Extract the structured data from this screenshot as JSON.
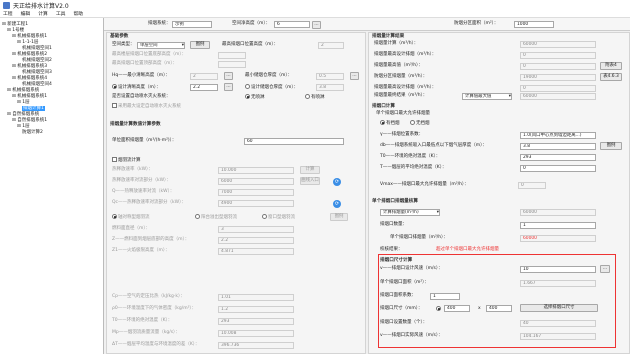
{
  "window": {
    "title": "天正给排水计算V2.0"
  },
  "menu": [
    "工程",
    "编辑",
    "计算",
    "工具",
    "帮助"
  ],
  "topbar": {
    "name_label": "排烟系统：",
    "name_value": "示例",
    "space_h_label": "空间净高度（m）：",
    "space_h_value": "6",
    "area_label": "防烟分区面积（m²）：",
    "area_value": "1000"
  },
  "tree": [
    {
      "t": "新建工程1",
      "l": 0
    },
    {
      "t": "1号楼",
      "l": 1
    },
    {
      "t": "机械排烟系统1",
      "l": 2
    },
    {
      "t": "1-1-1层",
      "l": 3
    },
    {
      "t": "机械排烟空间1",
      "l": 4
    },
    {
      "t": "机械排烟系统2",
      "l": 2
    },
    {
      "t": "机械排烟空间2",
      "l": 4
    },
    {
      "t": "机械排烟系统3",
      "l": 2
    },
    {
      "t": "机械排烟空间3",
      "l": 4
    },
    {
      "t": "机械排烟系统4",
      "l": 2
    },
    {
      "t": "机械排烟空间4",
      "l": 4
    },
    {
      "t": "机械排烟系统",
      "l": 1
    },
    {
      "t": "机械排烟系统1",
      "l": 2
    },
    {
      "t": "1层",
      "l": 3
    },
    {
      "t": "排烟计算1",
      "l": 4,
      "sel": true
    },
    {
      "t": "自然排烟系统",
      "l": 1
    },
    {
      "t": "自然排烟系统1",
      "l": 2
    },
    {
      "t": "1层",
      "l": 3
    },
    {
      "t": "防烟计算2",
      "l": 4
    }
  ],
  "left": {
    "sec1": "基础参数",
    "space_type_label": "空间类型：",
    "space_type_value": "单层空间",
    "space_type_btn": "图例",
    "max_area_label": "最高排烟口位置高度（m）：",
    "max_area_value": "2",
    "row_a": "最高楼层排烟口位置底部高度（m）：",
    "row_b": "最高排烟口位置顶部高度（m）：",
    "h_label": "Hq——最小清晰高度（m）：",
    "h_value": "2",
    "min_thick_label": "最小储烟仓厚度（m）：",
    "min_thick_value": "0.5",
    "r1": "设计清晰高度（m）：",
    "r1_value": "2.2",
    "r2": "设计储烟仓厚度（m）：",
    "r2_value": "3.8",
    "cb_a": "是否设置自动喷水灭火系统：",
    "cb_a_opt1": "无喷淋",
    "cb_a_opt2": "有喷淋",
    "cb_b": "采用最大设定自动喷水灭火系统",
    "sec2": "排烟量计算数值计算参数",
    "unit_label": "单位面积排烟量（m³/(h·m²)）：",
    "unit_value": "60",
    "sec3": "烟羽流计算",
    "rows": [
      {
        "l": "热释放速率（kW）：",
        "v": "10.000",
        "b": "计算"
      },
      {
        "l": "热释放速率对流部分（kW）：",
        "v": "6000",
        "b": "曲线入口"
      },
      {
        "l": "Q——热释放速率对流（kW）：",
        "v": "7000",
        "b": ""
      },
      {
        "l": "Qc——热释放速率对流部分（kW）：",
        "v": "4900",
        "b": ""
      }
    ],
    "plume_radios": [
      "轴对称型烟羽流",
      "阳台溢出型烟羽流",
      "窗口型烟羽流"
    ],
    "plume_btn": "图例",
    "rows2": [
      {
        "l": "燃料面直径（m）：",
        "v": "3"
      },
      {
        "l": "Z——燃料面到烟层底部的高度（m）：",
        "v": "2.2"
      },
      {
        "l": "Z1——火焰极限高度（m）：",
        "v": "4.871"
      }
    ],
    "rows3": [
      {
        "l": "Cp——空气的定压比热（kJ/kg·k）：",
        "v": "1.01"
      },
      {
        "l": "ρ0——环境温度下的气体密度（kg/m³）：",
        "v": "1.2"
      },
      {
        "l": "T0——环境的绝对温度（K）：",
        "v": "293"
      },
      {
        "l": "Mp——烟羽流质量流量（kg/s）：",
        "v": "10.008"
      },
      {
        "l": "ΔT——烟层平均温度与环境温度的差（K）：",
        "v": "396.736"
      }
    ]
  },
  "right": {
    "sec1": "排烟量计算结果",
    "rows": [
      {
        "l": "排烟量计算（m³/h）：",
        "v": "60000"
      },
      {
        "l": "排烟量最高设计排烟（m³/h）：",
        "v": "0"
      },
      {
        "l": "排烟量最高值（m³/h）：",
        "v": "0",
        "b": "附表4"
      },
      {
        "l": "防烟分区排烟量（m³/h）：",
        "v": "19000",
        "b": "表4.6.3"
      },
      {
        "l": "排烟量最高设计排烟（m³/h）：",
        "v": "0"
      }
    ],
    "calc_label": "排烟量最终结果（m³/h）：",
    "calc_sel": "计算值最大值",
    "calc_val": "60000",
    "sec2": "排烟口计算",
    "sub2": "单个排烟口最大允许排烟量",
    "radio_a": "有挡烟",
    "radio_b": "无挡烟",
    "rows2": [
      {
        "l": "γ——排烟位置系数：",
        "v": "1.0(风口中心点到墙边距离...)"
      },
      {
        "l": "db——排烟系统吸入口最低点以下烟气层厚度（m）：",
        "v": "3.8",
        "b": "图例"
      },
      {
        "l": "T0——环境的绝对温度（K）：",
        "v": "293"
      },
      {
        "l": "T——烟层的平均绝对温度（K）：",
        "v": "0"
      }
    ],
    "vmax_label": "Vmax——排烟口最大允许排烟量（m³/h）：",
    "vmax_value": "0",
    "sec3": "单个排烟口排烟量核算",
    "exhaust_sel": "计算排烟量(m³/h)",
    "exh_val": "60000",
    "count_label": "排烟口数量：",
    "count_value": "1",
    "single_label": "单个排烟口排烟量（m³/h）：",
    "single_value": "60000",
    "check_label": "校核结果：",
    "check_value": "超过单个排烟口最大允许排烟量",
    "sec4": "排烟口尺寸计算",
    "v_label": "v——排烟口设计风速（m/s）：",
    "v_value": "10",
    "area_label": "单个排烟口面积（m²）：",
    "area_value": "1.667",
    "coef_label": "排烟口面积系数：",
    "coef_value": "1",
    "size_label": "排烟口尺寸（mm）：",
    "size_w": "400",
    "size_x": "x",
    "size_h": "400",
    "size_btn": "选择排烟口尺寸",
    "real_label": "排烟口设置数量（个）：",
    "real_value": "40",
    "real_v_label": "v——排烟口实际风速（m/s）：",
    "real_v_value": "104.167"
  },
  "colors": {
    "accent": "#3399ff",
    "highlight": "#e33333"
  }
}
